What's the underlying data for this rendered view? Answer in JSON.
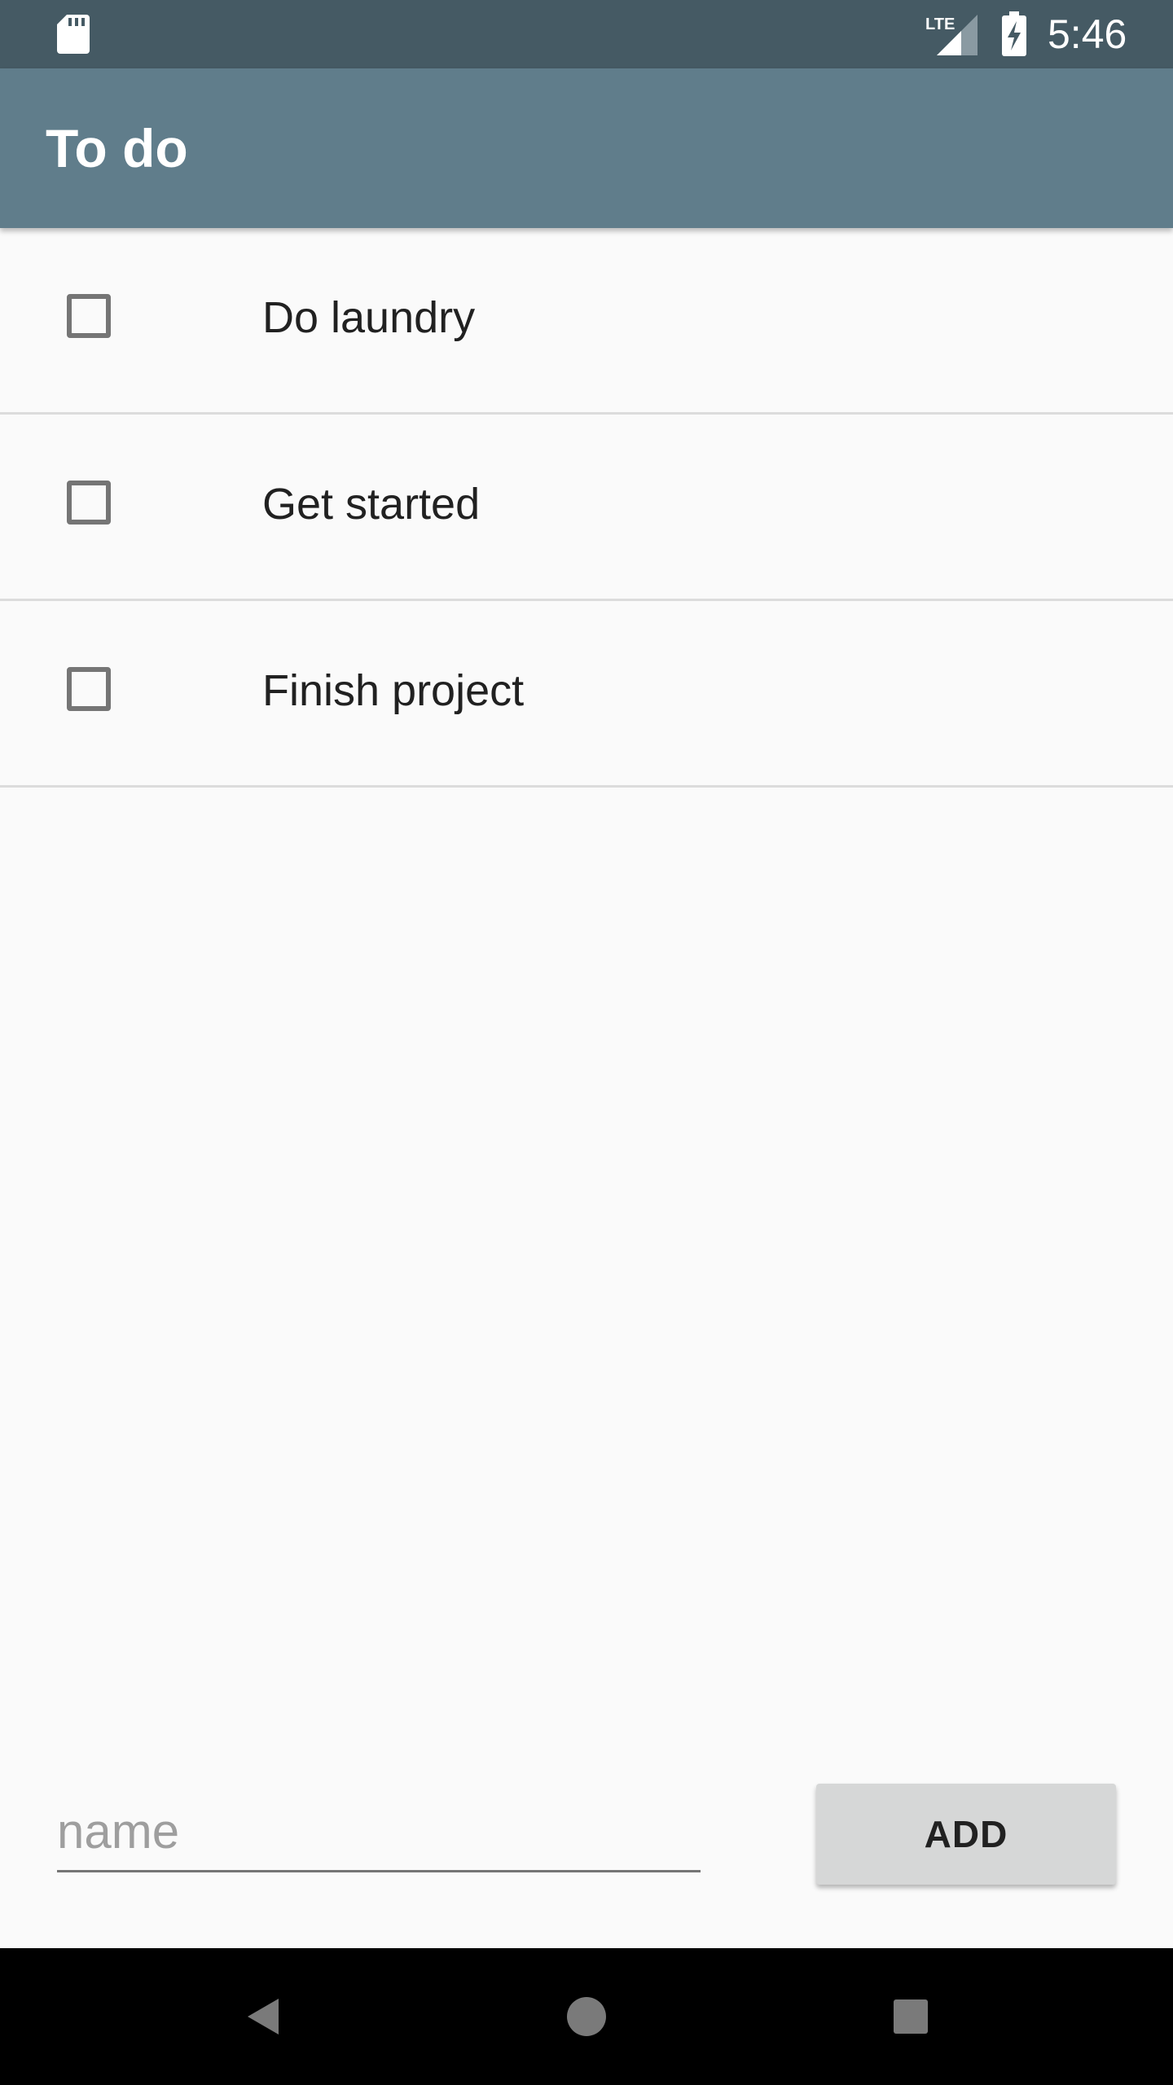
{
  "status_bar": {
    "time": "5:46",
    "network_label": "LTE",
    "icons": [
      "sd-card-icon",
      "lte-signal-icon",
      "battery-charging-icon"
    ]
  },
  "app_bar": {
    "title": "To do"
  },
  "todos": [
    {
      "label": "Do laundry",
      "checked": false
    },
    {
      "label": "Get started",
      "checked": false
    },
    {
      "label": "Finish project",
      "checked": false
    }
  ],
  "input": {
    "placeholder": "name",
    "value": ""
  },
  "add_button": {
    "label": "ADD"
  },
  "nav_bar": {
    "icons": [
      "back-icon",
      "home-icon",
      "recents-icon"
    ]
  },
  "colors": {
    "status_bar": "#455a64",
    "app_bar": "#607d8b",
    "background": "#fafafa",
    "button": "#d6d7d7",
    "nav_bar": "#000000"
  }
}
